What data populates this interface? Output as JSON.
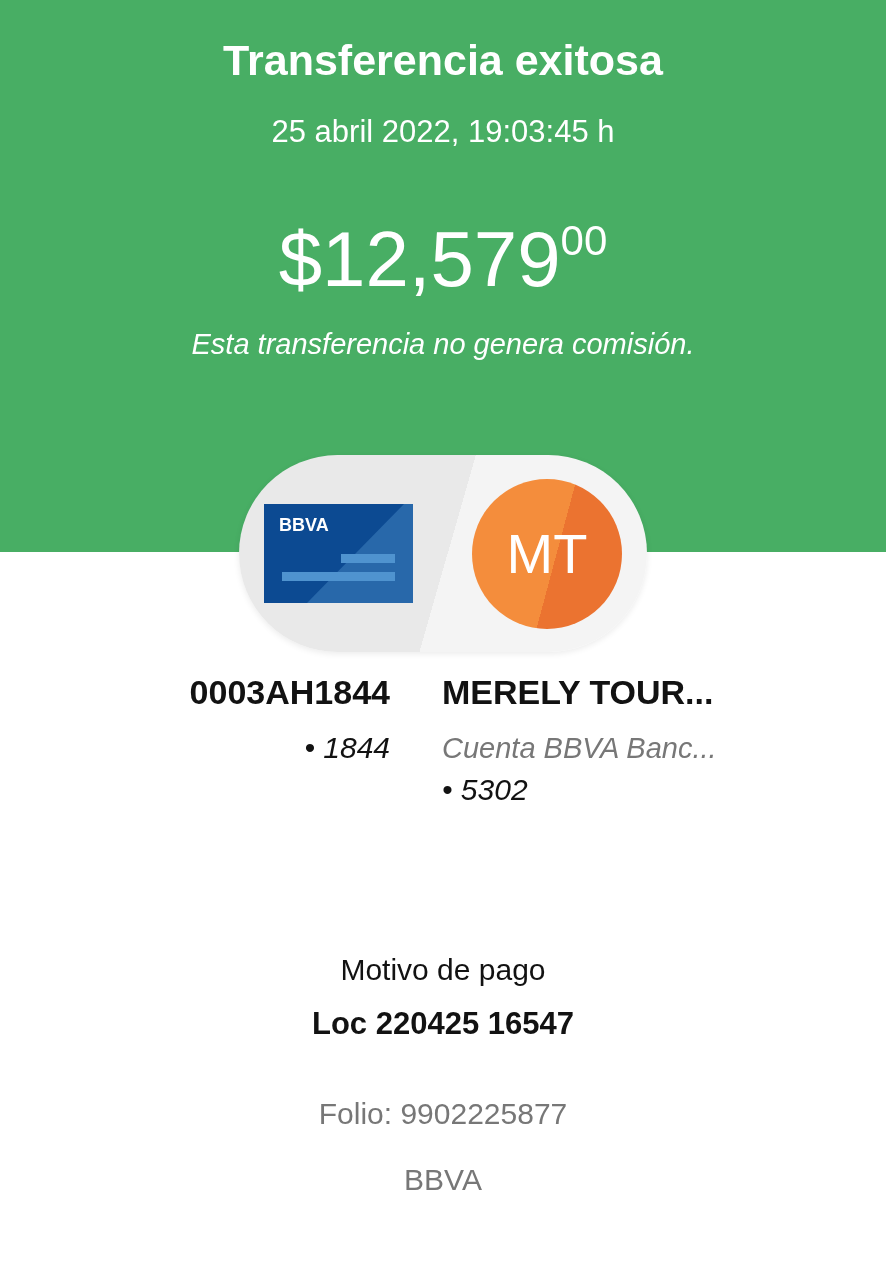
{
  "header": {
    "title": "Transferencia exitosa",
    "datetime": "25 abril 2022, 19:03:45 h",
    "amount": "$12,579",
    "cents": "00",
    "note": "Esta transferencia no genera comisión."
  },
  "origin": {
    "card_brand": "BBVA",
    "name": "0003AH1844",
    "account": "• 1844"
  },
  "destination": {
    "initials": "MT",
    "name": "MERELY TOUR...",
    "bank": "Cuenta BBVA Banc...",
    "account": "• 5302"
  },
  "details": {
    "label": "Motivo de pago",
    "value": "Loc 220425 16547",
    "folio": "Folio: 9902225877",
    "bank": "BBVA"
  }
}
